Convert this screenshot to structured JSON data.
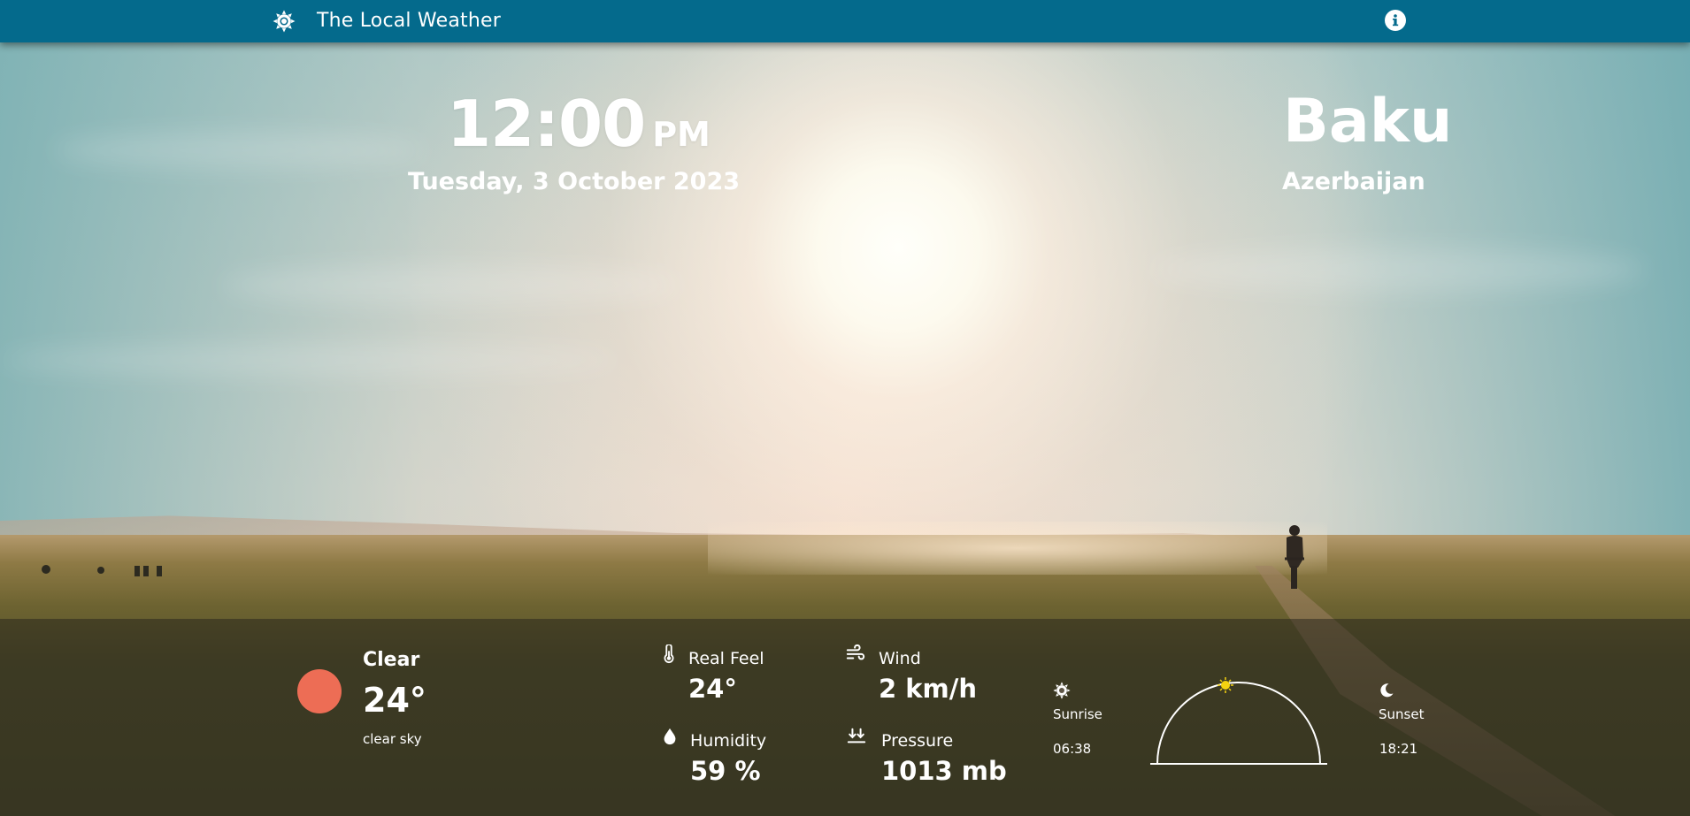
{
  "app": {
    "title": "The Local Weather",
    "logo_icon": "sun-gear-icon",
    "info_icon": "info-icon"
  },
  "clock": {
    "time": "12:00",
    "ampm": "PM",
    "date": "Tuesday, 3 October 2023"
  },
  "location": {
    "city": "Baku",
    "country": "Azerbaijan"
  },
  "current": {
    "condition": "Clear",
    "temperature": "24°",
    "description": "clear sky",
    "condition_color": "#ed6d55"
  },
  "metrics": {
    "real_feel": {
      "label": "Real Feel",
      "value": "24°",
      "icon": "thermometer-icon"
    },
    "wind": {
      "label": "Wind",
      "value": "2 km/h",
      "icon": "wind-icon"
    },
    "humidity": {
      "label": "Humidity",
      "value": "59 %",
      "icon": "droplet-icon"
    },
    "pressure": {
      "label": "Pressure",
      "value": "1013 mb",
      "icon": "pressure-down-arrows-icon"
    }
  },
  "sun": {
    "sunrise_label": "Sunrise",
    "sunrise_time": "06:38",
    "sunset_label": "Sunset",
    "sunset_time": "18:21",
    "sun_marker_color": "#f5d30f"
  },
  "colors": {
    "topbar": "#046a8c",
    "text": "#ffffff"
  }
}
